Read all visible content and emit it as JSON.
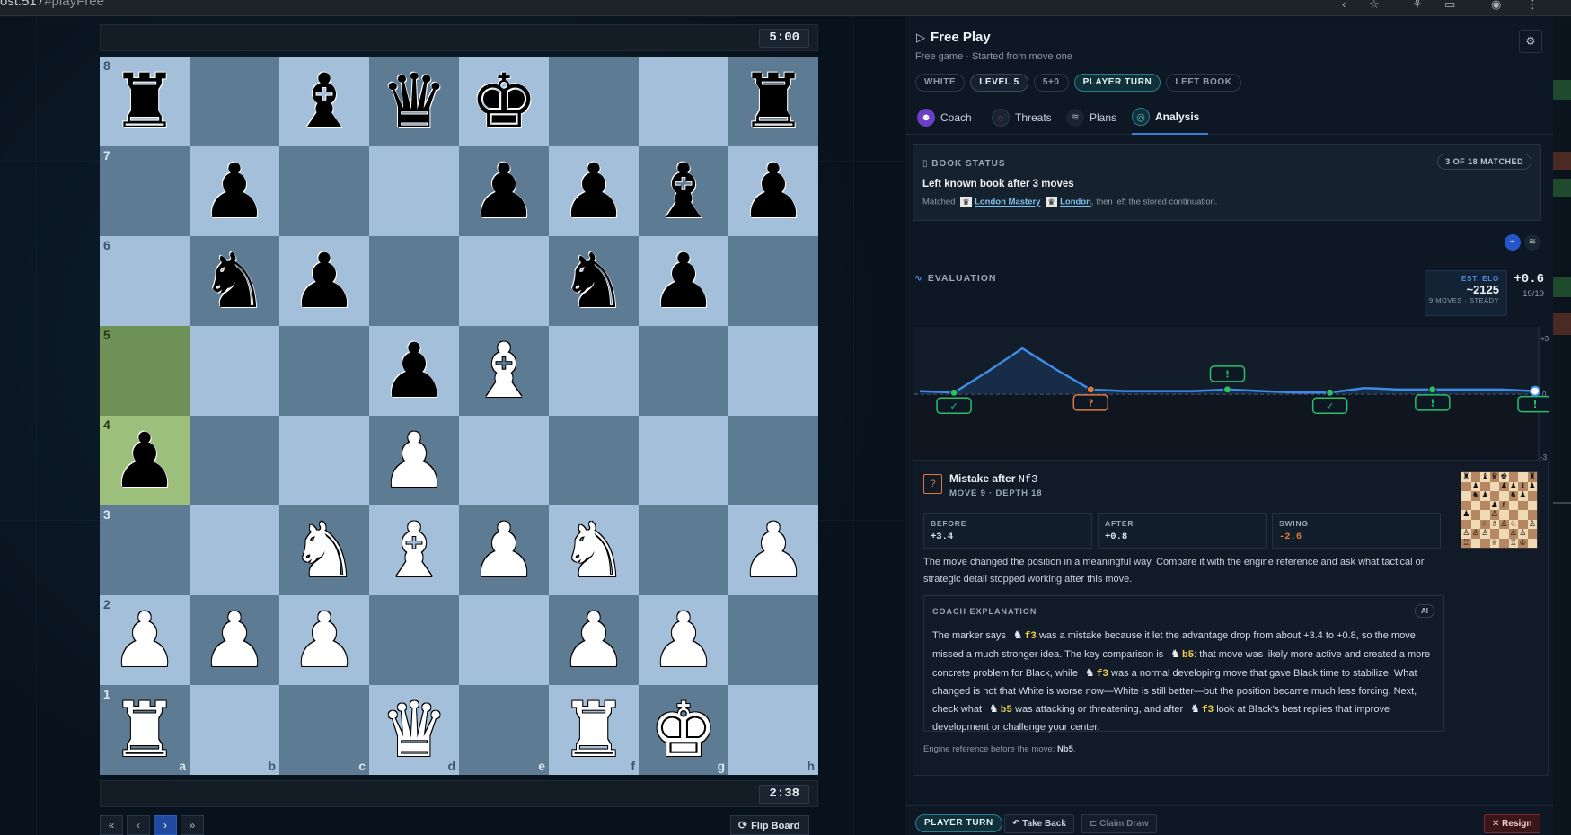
{
  "browser": {
    "url_prefix": "ost:517",
    "url_rest": "#playFree"
  },
  "clocks": {
    "top": "5:00",
    "bottom": "2:38"
  },
  "board": {
    "files": [
      "a",
      "b",
      "c",
      "d",
      "e",
      "f",
      "g",
      "h"
    ],
    "ranks": [
      "8",
      "7",
      "6",
      "5",
      "4",
      "3",
      "2",
      "1"
    ],
    "rows": [
      [
        "bR",
        "",
        "bB",
        "bQ",
        "bK",
        "",
        "",
        "bR"
      ],
      [
        "",
        "bP",
        "",
        "",
        "bP",
        "bP",
        "bB",
        "bP"
      ],
      [
        "",
        "bN",
        "bP",
        "",
        "",
        "bN",
        "bP",
        ""
      ],
      [
        "",
        "",
        "",
        "bP",
        "wB",
        "",
        "",
        ""
      ],
      [
        "bP",
        "",
        "",
        "wP",
        "",
        "",
        "",
        ""
      ],
      [
        "",
        "",
        "wN",
        "wB",
        "wP",
        "wN",
        "",
        "wP"
      ],
      [
        "wP",
        "wP",
        "wP",
        "",
        "",
        "wP",
        "wP",
        ""
      ],
      [
        "wR",
        "",
        "",
        "wQ",
        "",
        "wR",
        "wK",
        ""
      ]
    ],
    "highlight": [
      "a5",
      "a4"
    ]
  },
  "nav": {
    "first": "«",
    "prev": "‹",
    "next": "›",
    "last": "»",
    "flip": "Flip Board"
  },
  "panel": {
    "title": "Free Play",
    "subtitle": "Free game · Started from move one",
    "pills": [
      "WHITE",
      "LEVEL 5",
      "5+0",
      "PLAYER TURN",
      "LEFT BOOK"
    ],
    "tabs": [
      "Coach",
      "Threats",
      "Plans",
      "Analysis"
    ],
    "book": {
      "heading": "BOOK STATUS",
      "count": "3 OF 18 MATCHED",
      "title": "Left known book after 3 moves",
      "matched_label": "Matched",
      "line1": "London Mastery",
      "line2": "London",
      "tail": ", then left the stored continuation."
    },
    "evaluation": {
      "heading": "EVALUATION",
      "elo_label": "EST. ELO",
      "elo_value": "~2125",
      "elo_sub": "9 MOVES · STEADY",
      "score": "+0.6",
      "moves": "19/19",
      "axis_top": "+3",
      "axis_mid": "0",
      "axis_bottom": "-3"
    },
    "mistake": {
      "badge": "?",
      "title": "Mistake after",
      "move": "Nf3",
      "sub": "MOVE 9 · DEPTH 18",
      "before_label": "BEFORE",
      "before": "+3.4",
      "after_label": "AFTER",
      "after": "+0.8",
      "swing_label": "SWING",
      "swing": "-2.6",
      "body": "The move changed the position in a meaningful way. Compare it with the engine reference and ask what tactical or strategic detail stopped working after this move.",
      "coach_heading": "COACH EXPLANATION",
      "coach_badge": "AI",
      "coach": {
        "p1": "The marker says",
        "m1": "f3",
        "p2": "was a mistake because it let the advantage drop from about +3.4 to +0.8, so the move missed a much stronger idea. The key comparison is",
        "m2": "b5",
        "p3": ": that move was likely more active and created a more concrete problem for Black, while",
        "m3": "f3",
        "p4": "was a normal developing move that gave Black time to stabilize. What changed is not that White is worse now—White is still better—but the position became much less forcing. Next, check what",
        "m4": "b5",
        "p5": "was attacking or threatening, and after",
        "m5": "f3",
        "p6": "look at Black's best replies that improve development or challenge your center."
      },
      "engine_ref_label": "Engine reference before the move:",
      "engine_ref": "Nb5"
    },
    "footer": {
      "turn": "PLAYER TURN",
      "take_back": "Take Back",
      "claim_draw": "Claim Draw",
      "resign": "Resign"
    }
  },
  "chart_data": {
    "type": "line",
    "ylim": [
      -3,
      3
    ],
    "x": [
      1,
      2,
      3,
      4,
      5,
      6,
      7,
      8,
      9,
      10,
      11,
      12,
      13,
      14,
      15,
      16,
      17,
      18,
      19
    ],
    "values": [
      0.2,
      0.1,
      1.5,
      3.0,
      1.6,
      0.3,
      0.2,
      0.2,
      0.2,
      0.3,
      0.2,
      0.1,
      0.1,
      0.4,
      0.3,
      0.3,
      0.3,
      0.3,
      0.2
    ],
    "markers": [
      {
        "x": 2,
        "symbol": "✓",
        "color": "#2bbf6a"
      },
      {
        "x": 6,
        "symbol": "?",
        "color": "#e0783e"
      },
      {
        "x": 10,
        "symbol": "!",
        "color": "#2bbf6a"
      },
      {
        "x": 13,
        "symbol": "✓",
        "color": "#2bbf6a"
      },
      {
        "x": 16,
        "symbol": "!",
        "color": "#2bbf6a"
      },
      {
        "x": 19,
        "symbol": "!",
        "color": "#2bbf6a"
      }
    ],
    "colors": {
      "line": "#3f8ae6",
      "fill": "#1a3352"
    }
  },
  "colors": {
    "light_square": "#a3bfd9",
    "dark_square": "#5e7b94",
    "highlight": "#9cc07b",
    "accent": "#3d7dd8",
    "teal": "#2a7f8e",
    "mistake": "#e0783e"
  }
}
